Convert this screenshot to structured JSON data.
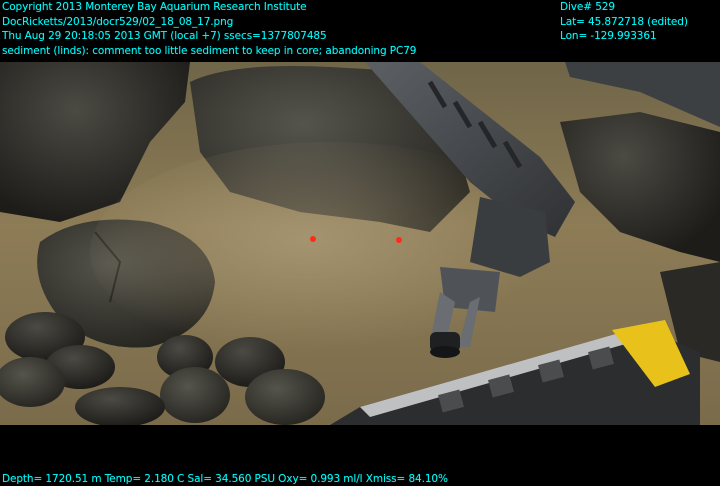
{
  "overlay": {
    "line1": "Copyright 2013 Monterey Bay Aquarium Research Institute",
    "line2": "DocRicketts/2013/docr529/02_18_08_17.png",
    "line3": "Thu Aug 29 20:18:05 2013 GMT (local +7)  ssecs=1377807485",
    "line4": "sediment (linds): comment too little sediment to keep in core; abandoning PC79",
    "dive": "Dive# 529",
    "lat": "Lat= 45.872718 (edited)",
    "lon": "Lon= -129.993361",
    "sensors": "Depth= 1720.51 m  Temp= 2.180 C  Sal= 34.560 PSU  Oxy= 0.993 ml/l  Xmiss= 84.10%"
  },
  "colors": {
    "overlay_text": "#00ffff",
    "background": "#000000",
    "sediment": "#8a7a55",
    "rock": "#3a3a36",
    "arm": "#4a4d50",
    "laser": "#ff2a1a",
    "yellow_bar": "#e8c21a"
  }
}
